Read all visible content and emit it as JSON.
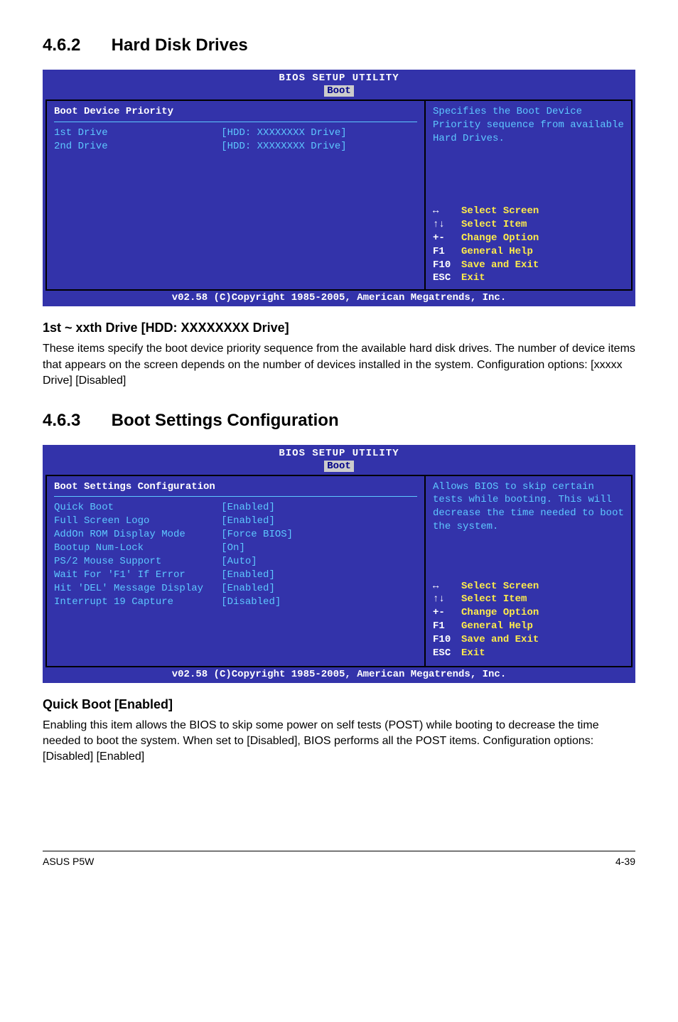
{
  "section_462": {
    "number": "4.6.2",
    "title": "Hard Disk Drives"
  },
  "bios1": {
    "title": "BIOS SETUP UTILITY",
    "tab": "Boot",
    "panel_heading": "Boot Device Priority",
    "rows": [
      {
        "label": "1st Drive",
        "value": "[HDD: XXXXXXXX Drive]"
      },
      {
        "label": "2nd Drive",
        "value": "[HDD: XXXXXXXX Drive]"
      }
    ],
    "help_text": "Specifies the Boot Device Priority sequence from available Hard Drives.",
    "nav": [
      {
        "key": "↔",
        "desc": "Select Screen"
      },
      {
        "key": "↑↓",
        "desc": "Select Item"
      },
      {
        "key": "+-",
        "desc": "Change Option"
      },
      {
        "key": "F1",
        "desc": "General Help"
      },
      {
        "key": "F10",
        "desc": "Save and Exit"
      },
      {
        "key": "ESC",
        "desc": "Exit"
      }
    ],
    "footer": "v02.58 (C)Copyright 1985-2005, American Megatrends, Inc."
  },
  "sub_1st": {
    "heading": "1st ~ xxth Drive [HDD: XXXXXXXX Drive]",
    "text": "These items specify the boot device priority sequence from the available hard disk drives. The number of device items that appears on the screen depends on the number of devices installed in the system. Configuration options: [xxxxx Drive] [Disabled]"
  },
  "section_463": {
    "number": "4.6.3",
    "title": "Boot Settings Configuration"
  },
  "bios2": {
    "title": "BIOS SETUP UTILITY",
    "tab": "Boot",
    "panel_heading": "Boot Settings Configuration",
    "rows": [
      {
        "label": "Quick Boot",
        "value": "[Enabled]"
      },
      {
        "label": "Full Screen Logo",
        "value": "[Enabled]"
      },
      {
        "label": "AddOn ROM Display Mode",
        "value": "[Force BIOS]"
      },
      {
        "label": "Bootup Num-Lock",
        "value": "[On]"
      },
      {
        "label": "PS/2 Mouse Support",
        "value": "[Auto]"
      },
      {
        "label": "Wait For 'F1' If Error",
        "value": "[Enabled]"
      },
      {
        "label": "Hit 'DEL' Message Display",
        "value": "[Enabled]"
      },
      {
        "label": "Interrupt 19 Capture",
        "value": "[Disabled]"
      }
    ],
    "help_text": "Allows BIOS to skip certain tests while booting. This will decrease the time needed to boot the system.",
    "nav": [
      {
        "key": "↔",
        "desc": "Select Screen"
      },
      {
        "key": "↑↓",
        "desc": "Select Item"
      },
      {
        "key": "+-",
        "desc": "Change Option"
      },
      {
        "key": "F1",
        "desc": "General Help"
      },
      {
        "key": "F10",
        "desc": "Save and Exit"
      },
      {
        "key": "ESC",
        "desc": "Exit"
      }
    ],
    "footer": "v02.58 (C)Copyright 1985-2005, American Megatrends, Inc."
  },
  "sub_quick": {
    "heading": "Quick Boot [Enabled]",
    "text": "Enabling this item allows the BIOS to skip some power on self tests (POST) while booting to decrease the time needed to boot the system. When set to [Disabled], BIOS performs all the POST items. Configuration options: [Disabled] [Enabled]"
  },
  "footer": {
    "left": "ASUS P5W",
    "right": "4-39"
  }
}
